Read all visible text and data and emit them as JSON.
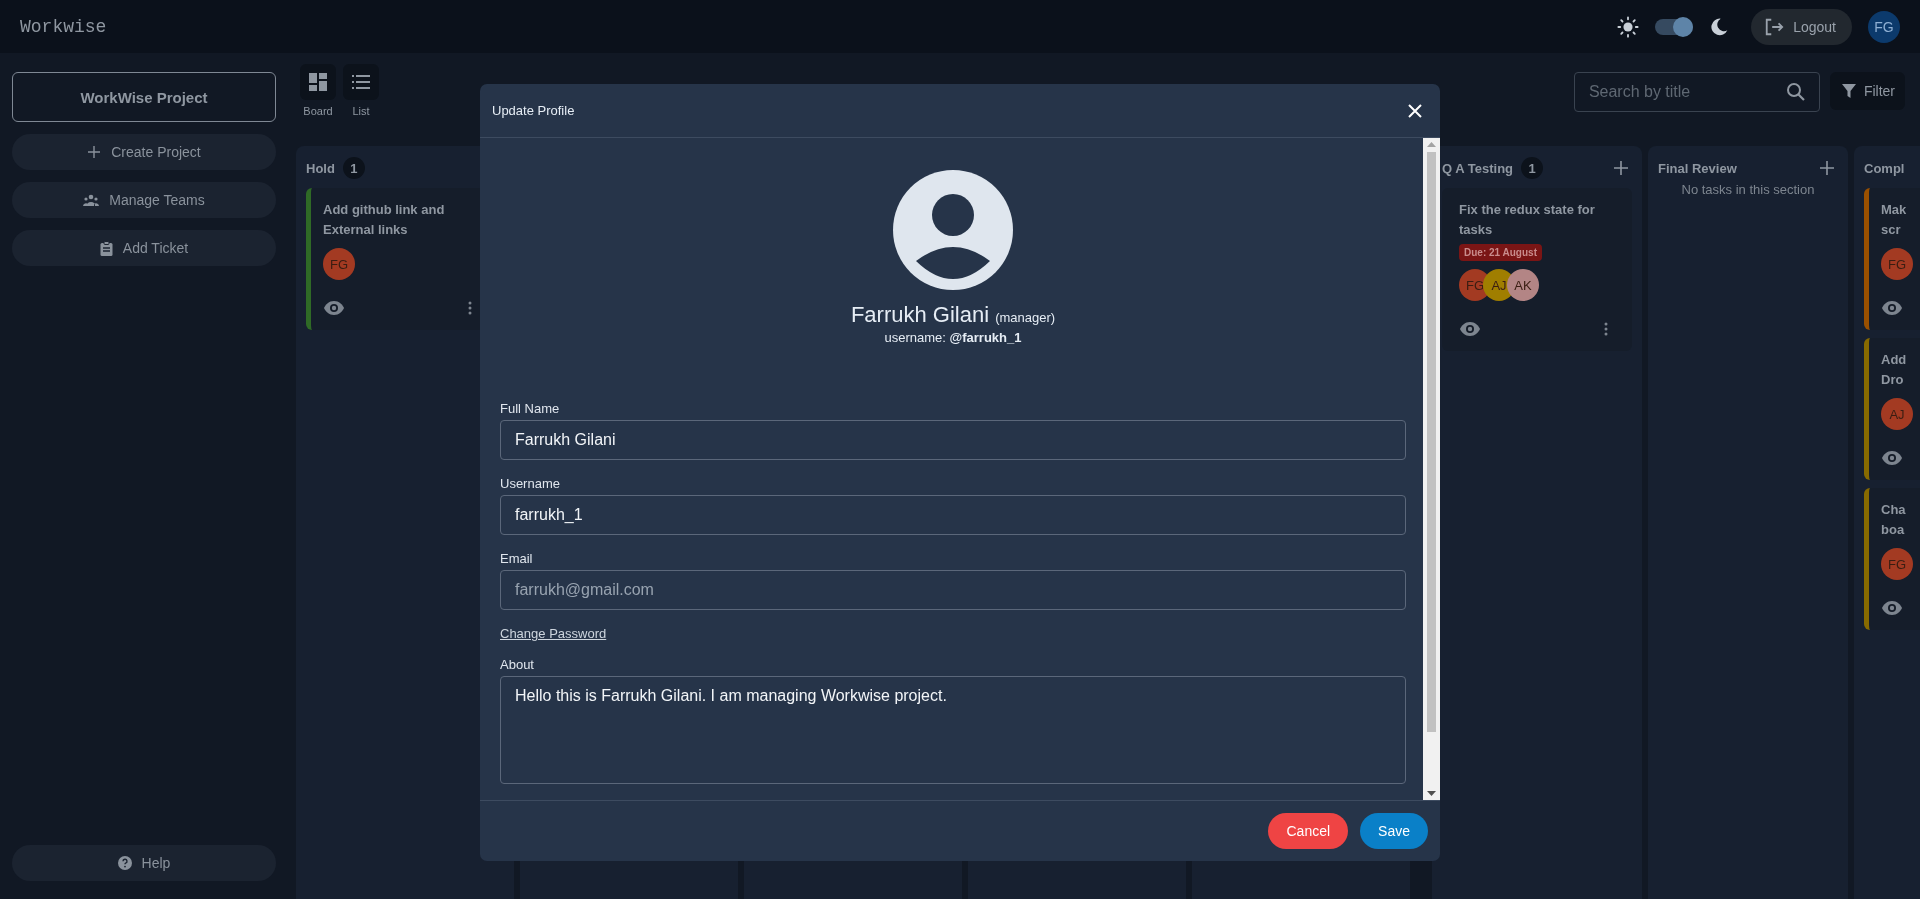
{
  "app": {
    "title": "Workwise"
  },
  "header": {
    "theme_toggle": {
      "on": true
    },
    "logout": "Logout",
    "avatar": "FG"
  },
  "sidebar": {
    "project": "WorkWise Project",
    "actions": [
      {
        "label": "Create Project",
        "kind": "plus"
      },
      {
        "label": "Manage Teams",
        "kind": "team"
      },
      {
        "label": "Add Ticket",
        "kind": "clipboard"
      }
    ],
    "help": "Help"
  },
  "toolbar": {
    "views": [
      "Board",
      "List"
    ],
    "search": {
      "placeholder": "Search by title"
    },
    "filter": "Filter"
  },
  "board": {
    "columns": [
      {
        "name": "Hold",
        "count": "1",
        "cards": [
          {
            "title_lines": [
              "Add github link and",
              "External links"
            ],
            "color": "#2f6a26",
            "menu": true,
            "avatars": [
              {
                "initials": "FG",
                "color": "#a33a22"
              }
            ]
          }
        ]
      },
      {
        "name": "Q A Testing",
        "count": "1",
        "add": true,
        "cards": [
          {
            "title_lines": [
              "Fix the redux state for",
              "tasks"
            ],
            "due": "Due: 21 August",
            "menu": true,
            "avatars": [
              {
                "initials": "FG",
                "color": "#a33a22"
              },
              {
                "initials": "AJ",
                "color": "#a07e00"
              },
              {
                "initials": "AK",
                "color": "#b38585"
              }
            ]
          }
        ]
      },
      {
        "name": "Final Review",
        "add": true,
        "empty_text": "No tasks in this section"
      },
      {
        "name": "Compl",
        "cards": [
          {
            "title_lines": [
              "Mak",
              "scr"
            ],
            "color": "#9a5000",
            "avatars": [
              {
                "initials": "FG",
                "color": "#a33a22"
              }
            ]
          },
          {
            "title_lines": [
              "Add",
              "Dro"
            ],
            "color": "#876a00",
            "avatars": [
              {
                "initials": "AJ",
                "color": "#a33a22"
              }
            ]
          },
          {
            "title_lines": [
              "Cha",
              "boa"
            ],
            "color": "#876a00",
            "avatars": [
              {
                "initials": "FG",
                "color": "#a33a22"
              }
            ]
          }
        ]
      }
    ]
  },
  "modal": {
    "title": "Update Profile",
    "name": "Farrukh Gilani",
    "role": "(manager)",
    "username_line": "username: **@farrukh_1**",
    "fields": [
      {
        "label": "Full Name",
        "value": "Farrukh Gilani",
        "disabled": false
      },
      {
        "label": "Username",
        "value": "farrukh_1",
        "disabled": false
      },
      {
        "label": "Email",
        "value": "farrukh@gmail.com",
        "disabled": true
      }
    ],
    "link": "Change Password",
    "about": {
      "label": "About",
      "value": "Hello this is Farrukh Gilani. I am managing Workwise project."
    },
    "buttons": [
      {
        "label": "Cancel",
        "kind": "cancel"
      },
      {
        "label": "Save",
        "kind": "save"
      }
    ]
  }
}
